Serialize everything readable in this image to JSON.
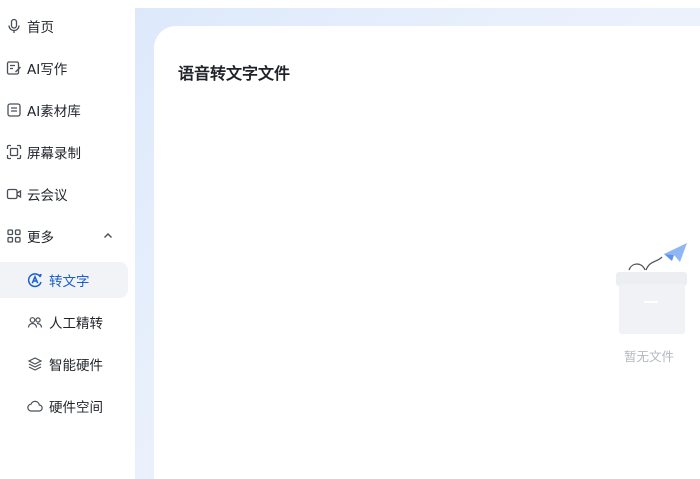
{
  "sidebar": {
    "items": [
      {
        "label": "首页",
        "icon": "microphone-icon"
      },
      {
        "label": "AI写作",
        "icon": "edit-doc-icon"
      },
      {
        "label": "AI素材库",
        "icon": "material-library-icon"
      },
      {
        "label": "屏幕录制",
        "icon": "screen-record-icon"
      },
      {
        "label": "云会议",
        "icon": "video-meeting-icon"
      },
      {
        "label": "更多",
        "icon": "grid-icon",
        "expanded": true
      }
    ],
    "sub_items": [
      {
        "label": "转文字",
        "icon": "ai-transcribe-icon",
        "active": true
      },
      {
        "label": "人工精转",
        "icon": "people-icon"
      },
      {
        "label": "智能硬件",
        "icon": "layers-icon"
      },
      {
        "label": "硬件空间",
        "icon": "cloud-icon"
      }
    ]
  },
  "main": {
    "title": "语音转文字文件",
    "empty_text": "暂无文件"
  },
  "colors": {
    "accent": "#1a5fd0",
    "active_bg": "#f1f3f6",
    "muted_text": "#b3b8c0"
  }
}
